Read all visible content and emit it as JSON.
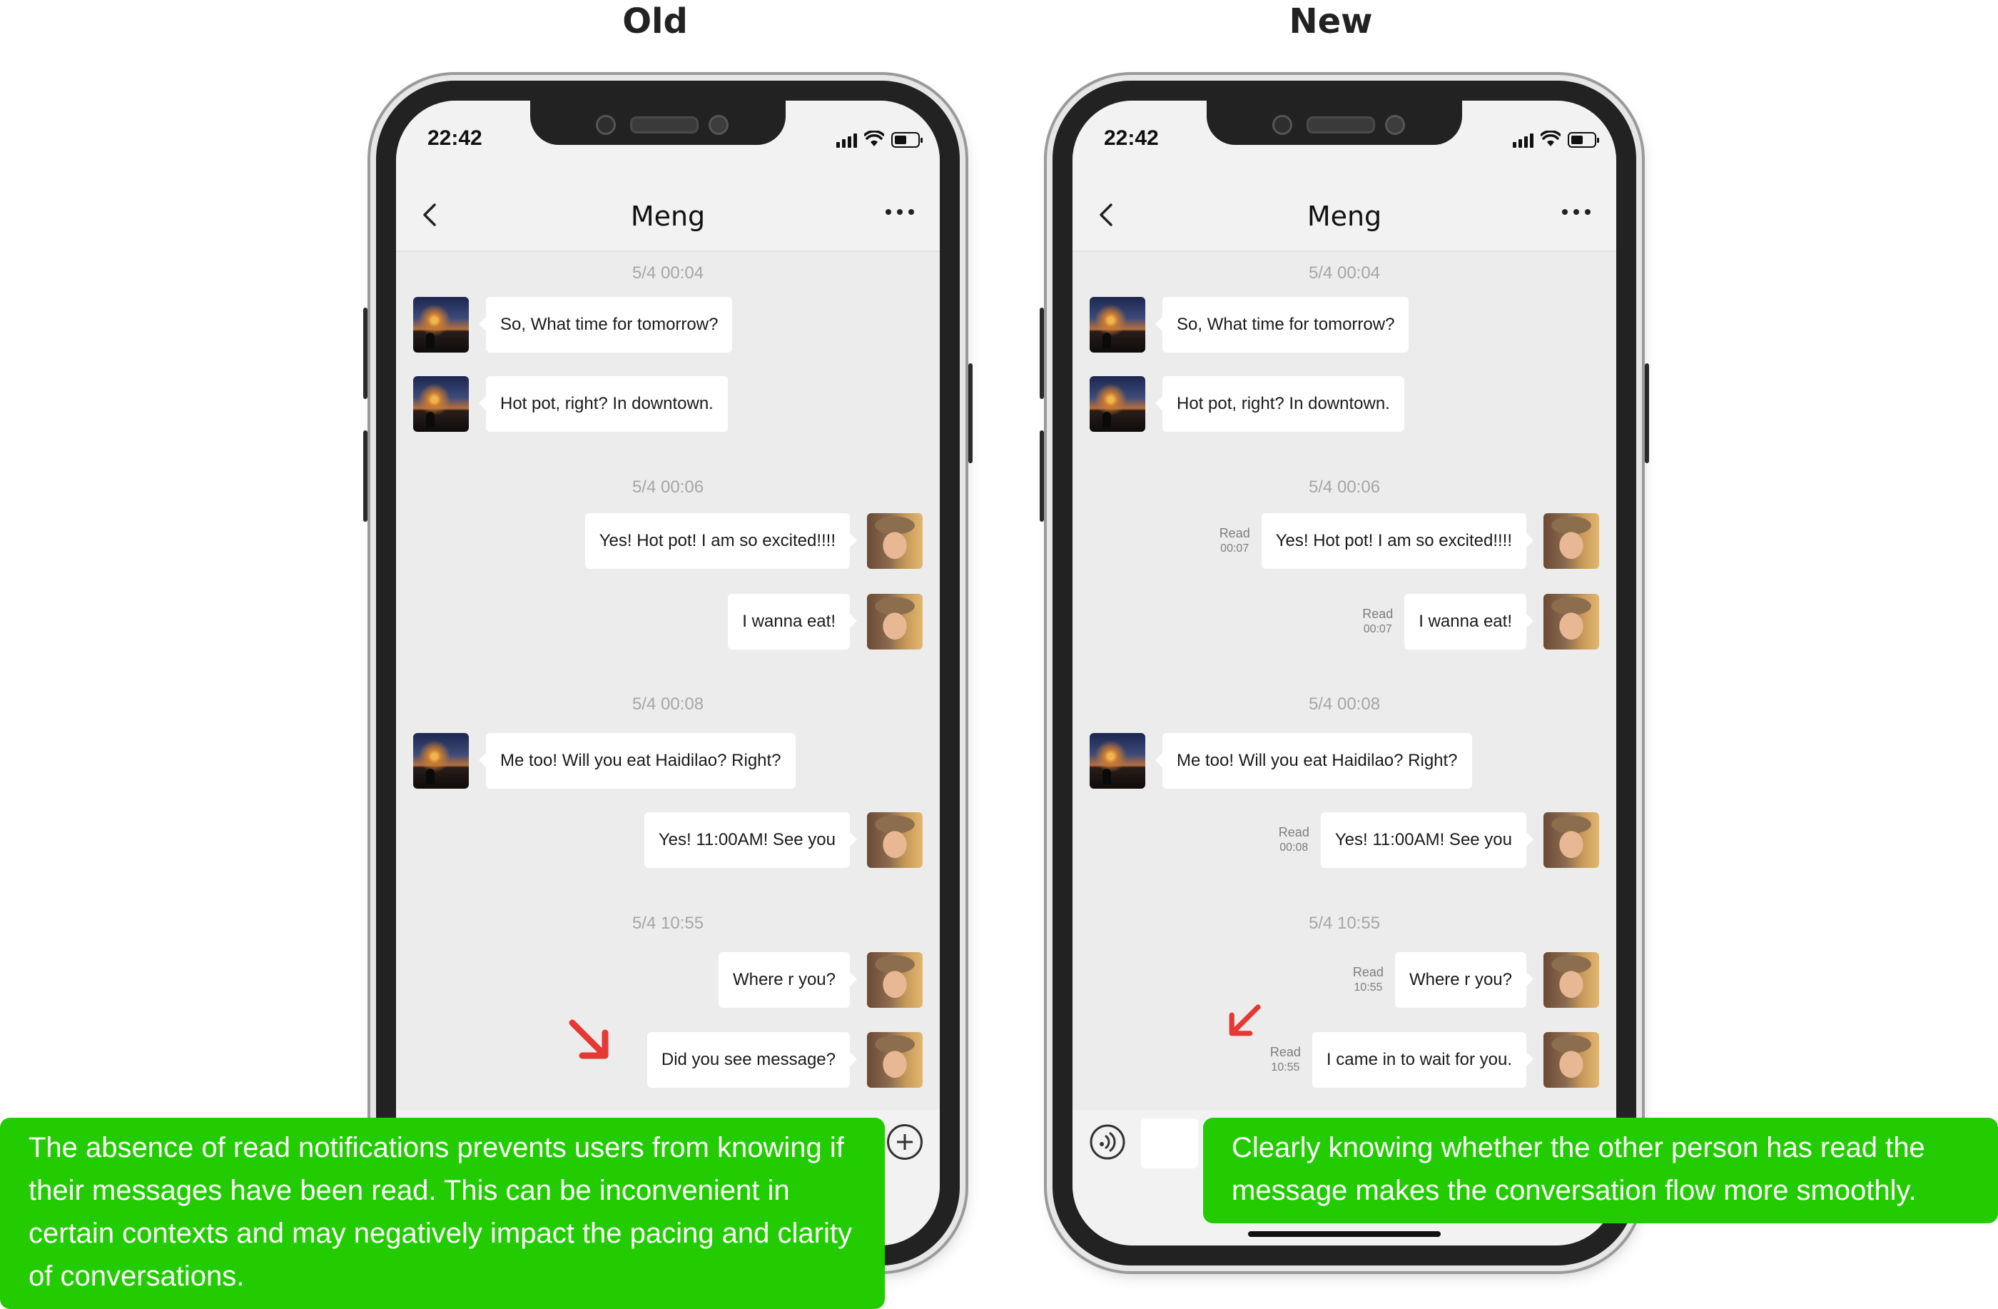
{
  "titles": {
    "old": "Old",
    "new": "New"
  },
  "status": {
    "time": "22:42"
  },
  "chat": {
    "contact": "Meng",
    "timestamps": [
      "5/4 00:04",
      "5/4 00:06",
      "5/4 00:08",
      "5/4 10:55"
    ],
    "messages": {
      "m1": "So, What time for tomorrow?",
      "m2": "Hot pot, right? In downtown.",
      "m3": "Yes! Hot pot! I am so excited!!!!",
      "m4": "I wanna eat!",
      "m5": "Me too! Will you eat Haidilao? Right?",
      "m6": "Yes! 11:00AM! See you",
      "m7": "Where r you?",
      "m8_old": "Did you see message?",
      "m8_new": "I came in to wait for you."
    },
    "read_label": "Read",
    "read_times": {
      "m3": "00:07",
      "m4": "00:07",
      "m6": "00:08",
      "m7": "10:55",
      "m8": "10:55"
    }
  },
  "callouts": {
    "old": "The absence of read notifications prevents users from knowing if their messages have been read. This can be inconvenient in certain contexts and may negatively impact the pacing and clarity of conversations.",
    "new": "Clearly knowing whether the other person has read the message makes the conversation flow more smoothly."
  },
  "colors": {
    "callout_bg": "#22cc00",
    "arrow": "#e53935",
    "chat_bg": "#ececec"
  },
  "icons": [
    "back-chevron-icon",
    "more-dots-icon",
    "signal-icon",
    "wifi-icon",
    "battery-icon",
    "voice-icon",
    "plus-icon",
    "arrow-icon"
  ]
}
